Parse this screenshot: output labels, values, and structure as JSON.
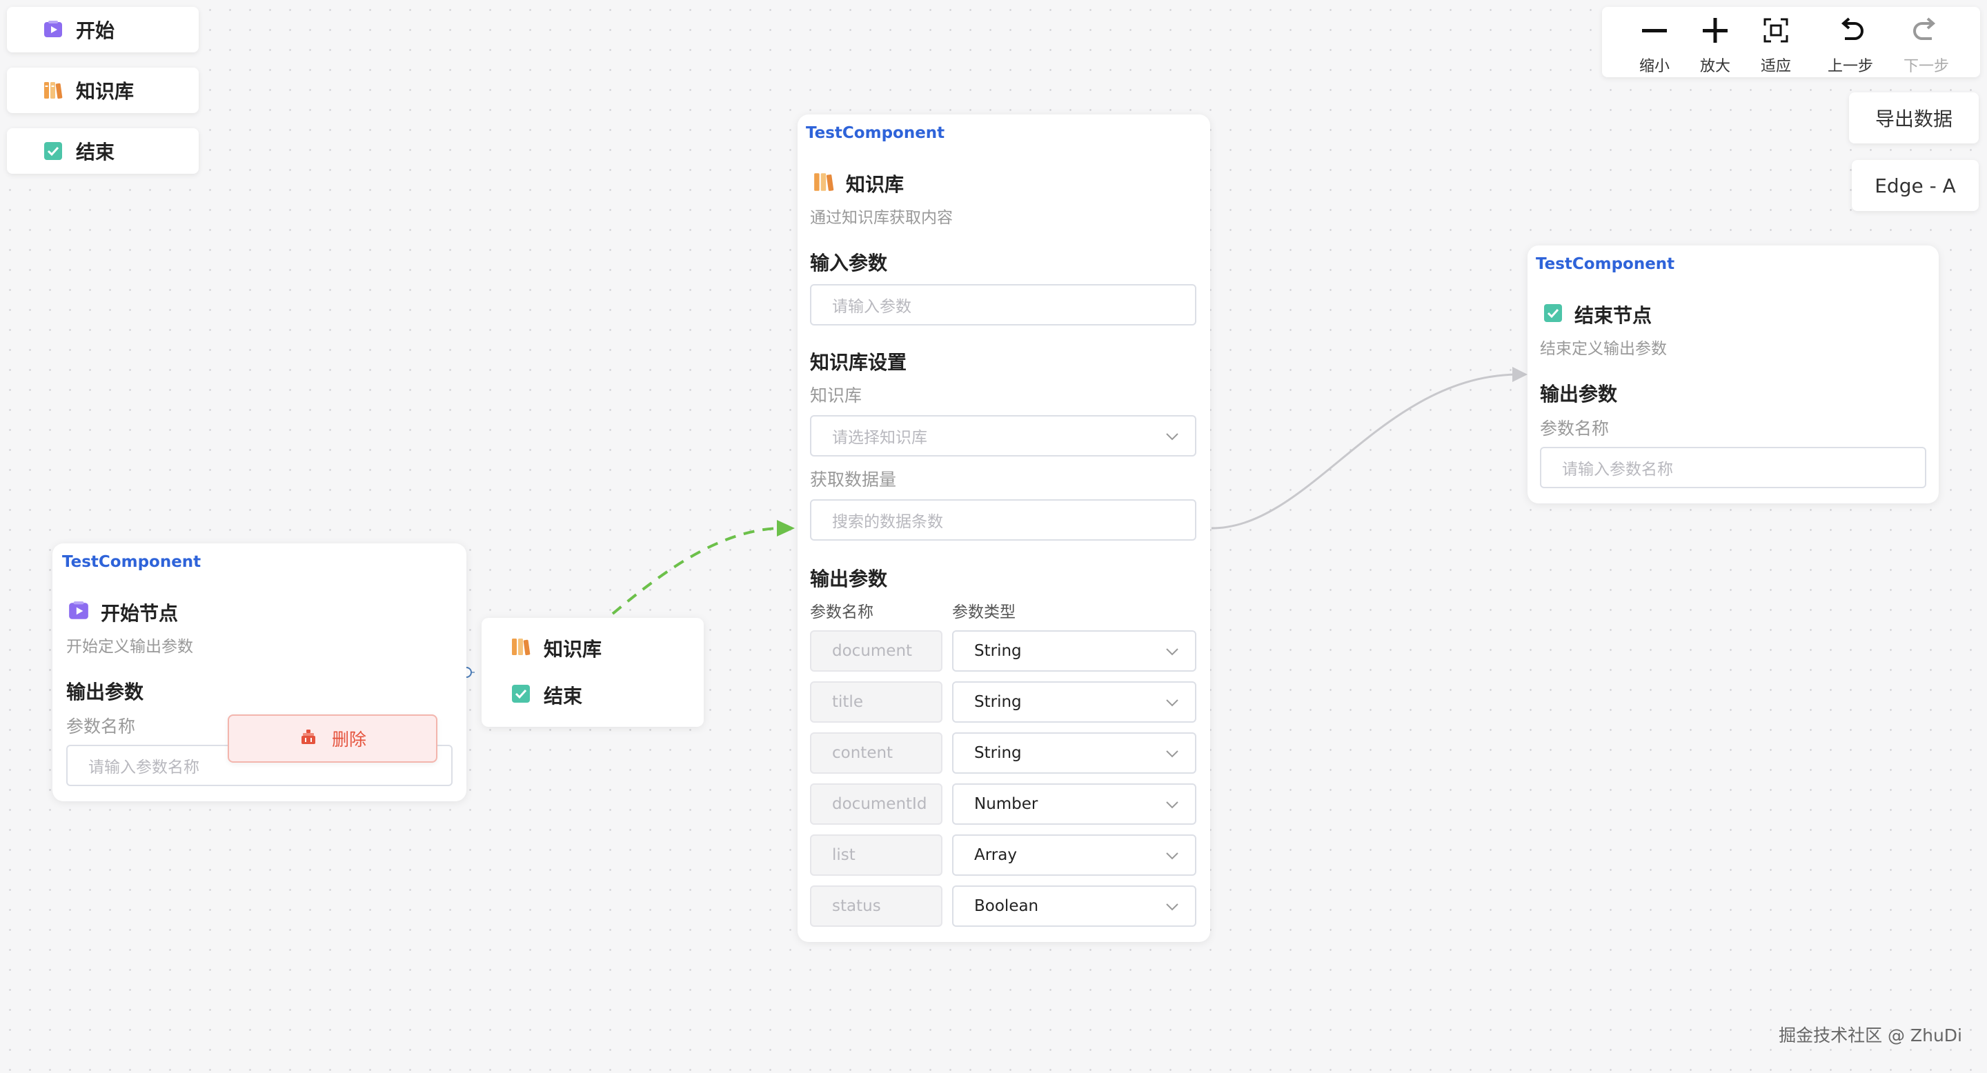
{
  "palette": [
    {
      "label": "开始",
      "icon": "start-icon"
    },
    {
      "label": "知识库",
      "icon": "knowledge-icon"
    },
    {
      "label": "结束",
      "icon": "end-icon"
    }
  ],
  "toolbar": {
    "zoom_out": "缩小",
    "zoom_in": "放大",
    "fit": "适应",
    "undo": "上一步",
    "redo": "下一步"
  },
  "export_button": "导出数据",
  "edge_button": "Edge - A",
  "start_node": {
    "component": "TestComponent",
    "title": "开始节点",
    "description": "开始定义输出参数",
    "section": "输出参数",
    "field_label": "参数名称",
    "input_placeholder": "请输入参数名称",
    "delete_label": "删除"
  },
  "popup_menu": {
    "items": [
      {
        "label": "知识库",
        "icon": "knowledge-icon"
      },
      {
        "label": "结束",
        "icon": "end-icon"
      }
    ]
  },
  "knowledge_node": {
    "component": "TestComponent",
    "title": "知识库",
    "description": "通过知识库获取内容",
    "input_section": "输入参数",
    "input_placeholder": "请输入参数",
    "settings_section": "知识库设置",
    "kb_label": "知识库",
    "kb_placeholder": "请选择知识库",
    "count_label": "获取数据量",
    "count_placeholder": "搜索的数据条数",
    "output_section": "输出参数",
    "col_name": "参数名称",
    "col_type": "参数类型",
    "params": [
      {
        "name": "document",
        "type": "String"
      },
      {
        "name": "title",
        "type": "String"
      },
      {
        "name": "content",
        "type": "String"
      },
      {
        "name": "documentId",
        "type": "Number"
      },
      {
        "name": "list",
        "type": "Array"
      },
      {
        "name": "status",
        "type": "Boolean"
      }
    ]
  },
  "end_node": {
    "component": "TestComponent",
    "title": "结束节点",
    "description": "结束定义输出参数",
    "section": "输出参数",
    "field_label": "参数名称",
    "input_placeholder": "请输入参数名称"
  },
  "watermark": "掘金技术社区 @ ZhuDi",
  "colors": {
    "component_title": "#2e63d9",
    "edge_active": "#6cc04a",
    "edge_default": "#c8c8cc",
    "delete_bg": "#fdecec",
    "delete_text": "#e5533d"
  }
}
